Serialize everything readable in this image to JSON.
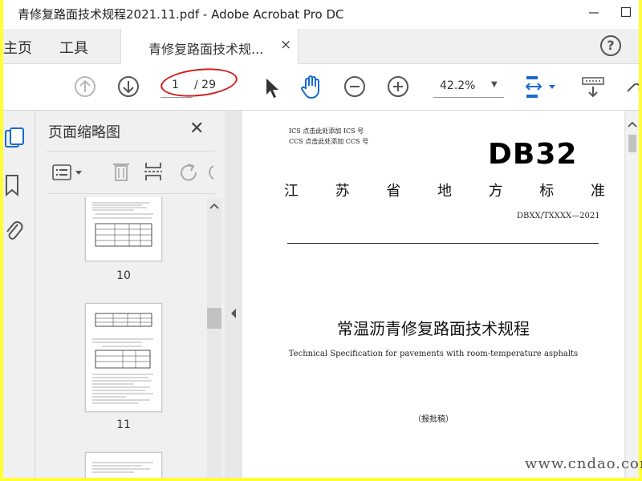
{
  "window": {
    "title": "青修复路面技术规程2021.11.pdf - Adobe Acrobat Pro DC",
    "minimize_icon": "minimize-icon",
    "maximize_icon": "maximize-icon"
  },
  "tabs": {
    "home": "主页",
    "tools": "工具",
    "document": "青修复路面技术规...",
    "close_glyph": "×",
    "help_glyph": "?"
  },
  "toolbar": {
    "page_current": "1",
    "page_total": "/ 29",
    "zoom": "42.2%",
    "zoom_caret": "▼",
    "highlight_color": "#d51c1c"
  },
  "thumbnails": {
    "panel_title": "页面缩略图",
    "close_glyph": "✕",
    "pages": [
      {
        "number": "10"
      },
      {
        "number": "11"
      }
    ]
  },
  "document": {
    "ics_line": "ICS 点击此处添加 ICS 号",
    "ccs_line": "CCS 点击此处添加 CCS 号",
    "standard_code": "DB32",
    "province_chars": [
      "江",
      "苏",
      "省",
      "地",
      "方",
      "标",
      "准"
    ],
    "doc_number": "DBXX/TXXXX—2021",
    "title_cn": "常温沥青修复路面技术规程",
    "title_en": "Technical Specification for pavements with room-temperature asphalts",
    "status": "（报批稿）"
  },
  "watermark": "www.cndao.com",
  "colors": {
    "outer_border": "#ffff33",
    "accent_blue": "#1a6bcf"
  }
}
